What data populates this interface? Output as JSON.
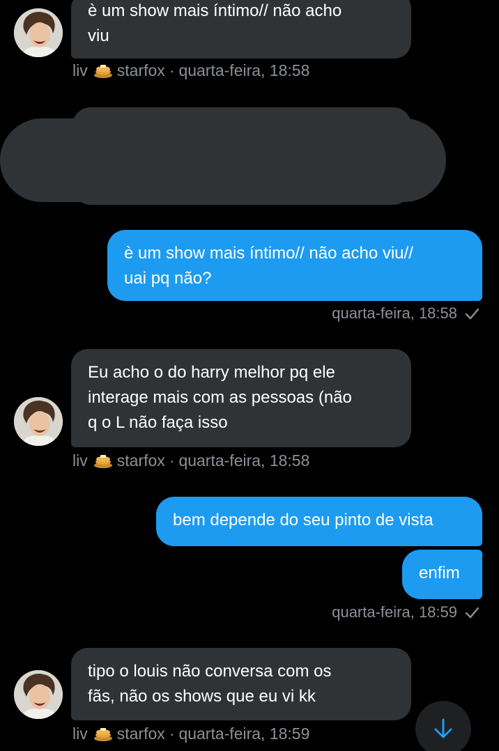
{
  "messages": [
    {
      "id": "m1",
      "type": "received",
      "text": "è um show mais íntimo// não acho\nviu"
    },
    {
      "id": "m2",
      "type": "sent",
      "text": "è um show mais íntimo// não acho viu//\nuai pq não?"
    },
    {
      "id": "m3",
      "type": "received",
      "text": "Eu acho o do harry melhor pq ele\ninterage mais com as pessoas (não\nq o L não faça isso"
    },
    {
      "id": "m4",
      "type": "sent",
      "text": "bem depende do seu pinto de vista"
    },
    {
      "id": "m5",
      "type": "sent",
      "text": "enfim"
    },
    {
      "id": "m6",
      "type": "received",
      "text": "tipo o louis não conversa com os\nfãs, não os shows que eu vi kk"
    }
  ],
  "received_meta": [
    {
      "name": "liv",
      "emoji": "pancakes-emoji",
      "handle": "starfox",
      "separator": "·",
      "time": "quarta-feira, 18:58"
    },
    {
      "name": "liv",
      "emoji": "pancakes-emoji",
      "handle": "starfox",
      "separator": "·",
      "time": "quarta-feira, 18:58"
    },
    {
      "name": "liv",
      "emoji": "pancakes-emoji",
      "handle": "starfox",
      "separator": "·",
      "time": "quarta-feira, 18:59"
    }
  ],
  "sent_meta": [
    {
      "time": "quarta-feira, 18:58",
      "status": "sent-check-icon"
    },
    {
      "time": "quarta-feira, 18:59",
      "status": "sent-check-icon"
    }
  ],
  "colors": {
    "background": "#000000",
    "received_bubble": "#2f3336",
    "sent_bubble": "#1d9bf0",
    "meta_text": "#8b9197",
    "accent": "#1d9bf0"
  },
  "scroll_button": {
    "icon": "arrow-down-icon"
  }
}
